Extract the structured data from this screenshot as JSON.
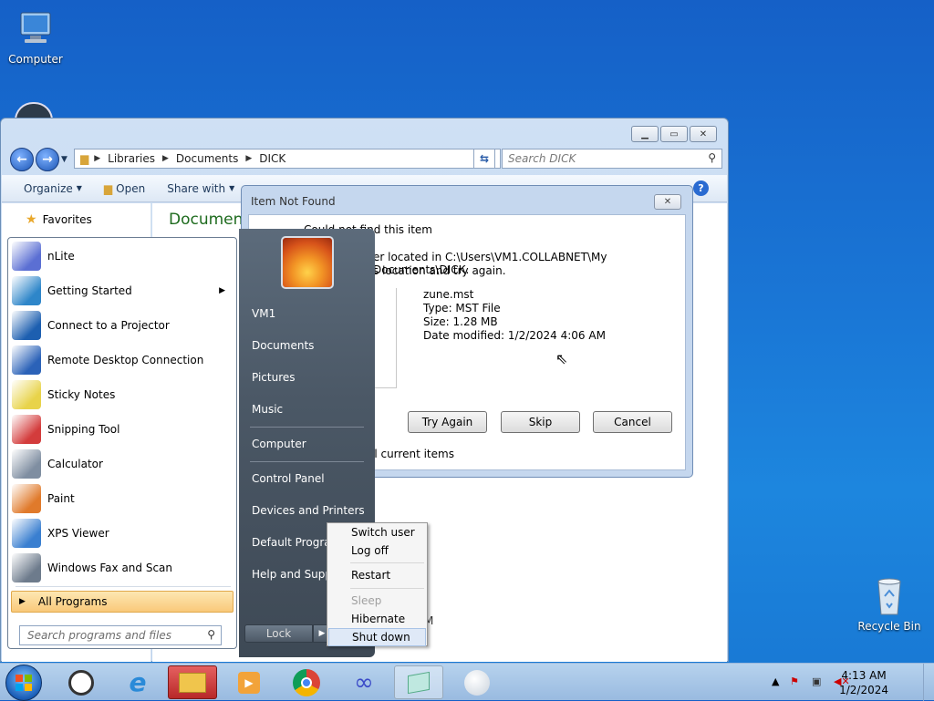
{
  "desktop": {
    "computer_label": "Computer",
    "recycle_label": "Recycle Bin"
  },
  "explorer": {
    "breadcrumbs": [
      "Libraries",
      "Documents",
      "DICK"
    ],
    "search_placeholder": "Search DICK",
    "toolbar": {
      "organize": "Organize",
      "open": "Open",
      "share_with": "Share with"
    },
    "nav_favorites": "Favorites",
    "content_heading": "Documen",
    "content_bottom_text": "M"
  },
  "dialog": {
    "title": "Item Not Found",
    "heading": "Could not find this item",
    "message_line1": "er located in C:\\Users\\VM1.COLLABNET\\My Documents\\DICK.",
    "message_line2": "s location and try again.",
    "file_name": "zune.mst",
    "file_type": "Type: MST File",
    "file_size": "Size: 1.28 MB",
    "file_modified": "Date modified: 1/2/2024 4:06 AM",
    "buttons": {
      "try_again": "Try Again",
      "skip": "Skip",
      "cancel": "Cancel"
    },
    "checkbox_text": "ll current items"
  },
  "start_menu": {
    "programs": [
      {
        "label": "nLite",
        "color": "#5b6fd3"
      },
      {
        "label": "Getting Started",
        "color": "#2e86c9"
      },
      {
        "label": "Connect to a Projector",
        "color": "#1d5fb0"
      },
      {
        "label": "Remote Desktop Connection",
        "color": "#2b62b8"
      },
      {
        "label": "Sticky Notes",
        "color": "#e8d34a"
      },
      {
        "label": "Snipping Tool",
        "color": "#d33c3c"
      },
      {
        "label": "Calculator",
        "color": "#7f8ea1"
      },
      {
        "label": "Paint",
        "color": "#e07a2b"
      },
      {
        "label": "XPS Viewer",
        "color": "#3a7fd0"
      },
      {
        "label": "Windows Fax and Scan",
        "color": "#6d7b8c"
      }
    ],
    "all_programs": "All Programs",
    "search_placeholder": "Search programs and files",
    "right_links": [
      "VM1",
      "Documents",
      "Pictures",
      "Music",
      "Computer",
      "Control Panel",
      "Devices and Printers",
      "Default Program",
      "Help and Suppo"
    ],
    "lock_label": "Lock"
  },
  "shutdown_menu": {
    "switch_user": "Switch user",
    "log_off": "Log off",
    "restart": "Restart",
    "sleep": "Sleep",
    "hibernate": "Hibernate",
    "shut_down": "Shut down"
  },
  "taskbar": {
    "time": "4:13 AM",
    "date": "1/2/2024"
  }
}
